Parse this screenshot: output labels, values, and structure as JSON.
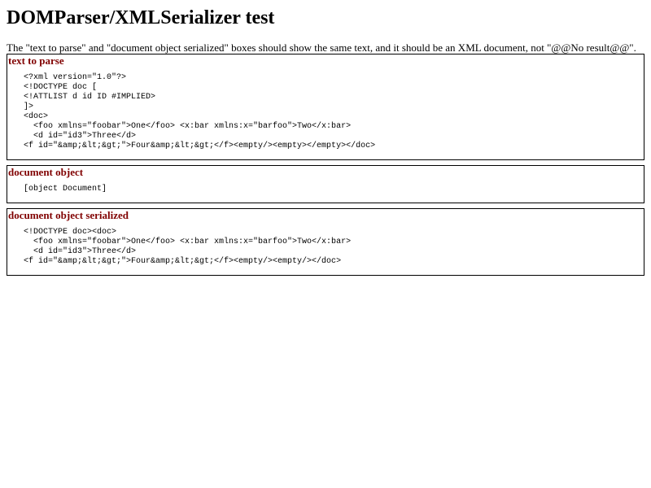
{
  "page": {
    "title": "DOMParser/XMLSerializer test",
    "intro": "The \"text to parse\" and \"document object serialized\" boxes should show the same text, and it should be an XML document, not \"@@No result@@\"."
  },
  "boxes": [
    {
      "title": "text to parse",
      "content": "<?xml version=\"1.0\"?>\n<!DOCTYPE doc [\n<!ATTLIST d id ID #IMPLIED>\n]>\n<doc>\n  <foo xmlns=\"foobar\">One</foo> <x:bar xmlns:x=\"barfoo\">Two</x:bar>\n  <d id=\"id3\">Three</d>\n<f id=\"&amp;&lt;&gt;\">Four&amp;&lt;&gt;</f><empty/><empty></empty></doc>"
    },
    {
      "title": "document object",
      "content": "[object Document]"
    },
    {
      "title": "document object serialized",
      "content": "<!DOCTYPE doc><doc>\n  <foo xmlns=\"foobar\">One</foo> <x:bar xmlns:x=\"barfoo\">Two</x:bar>\n  <d id=\"id3\">Three</d>\n<f id=\"&amp;&lt;&gt;\">Four&amp;&lt;&gt;</f><empty/><empty/></doc>"
    }
  ]
}
